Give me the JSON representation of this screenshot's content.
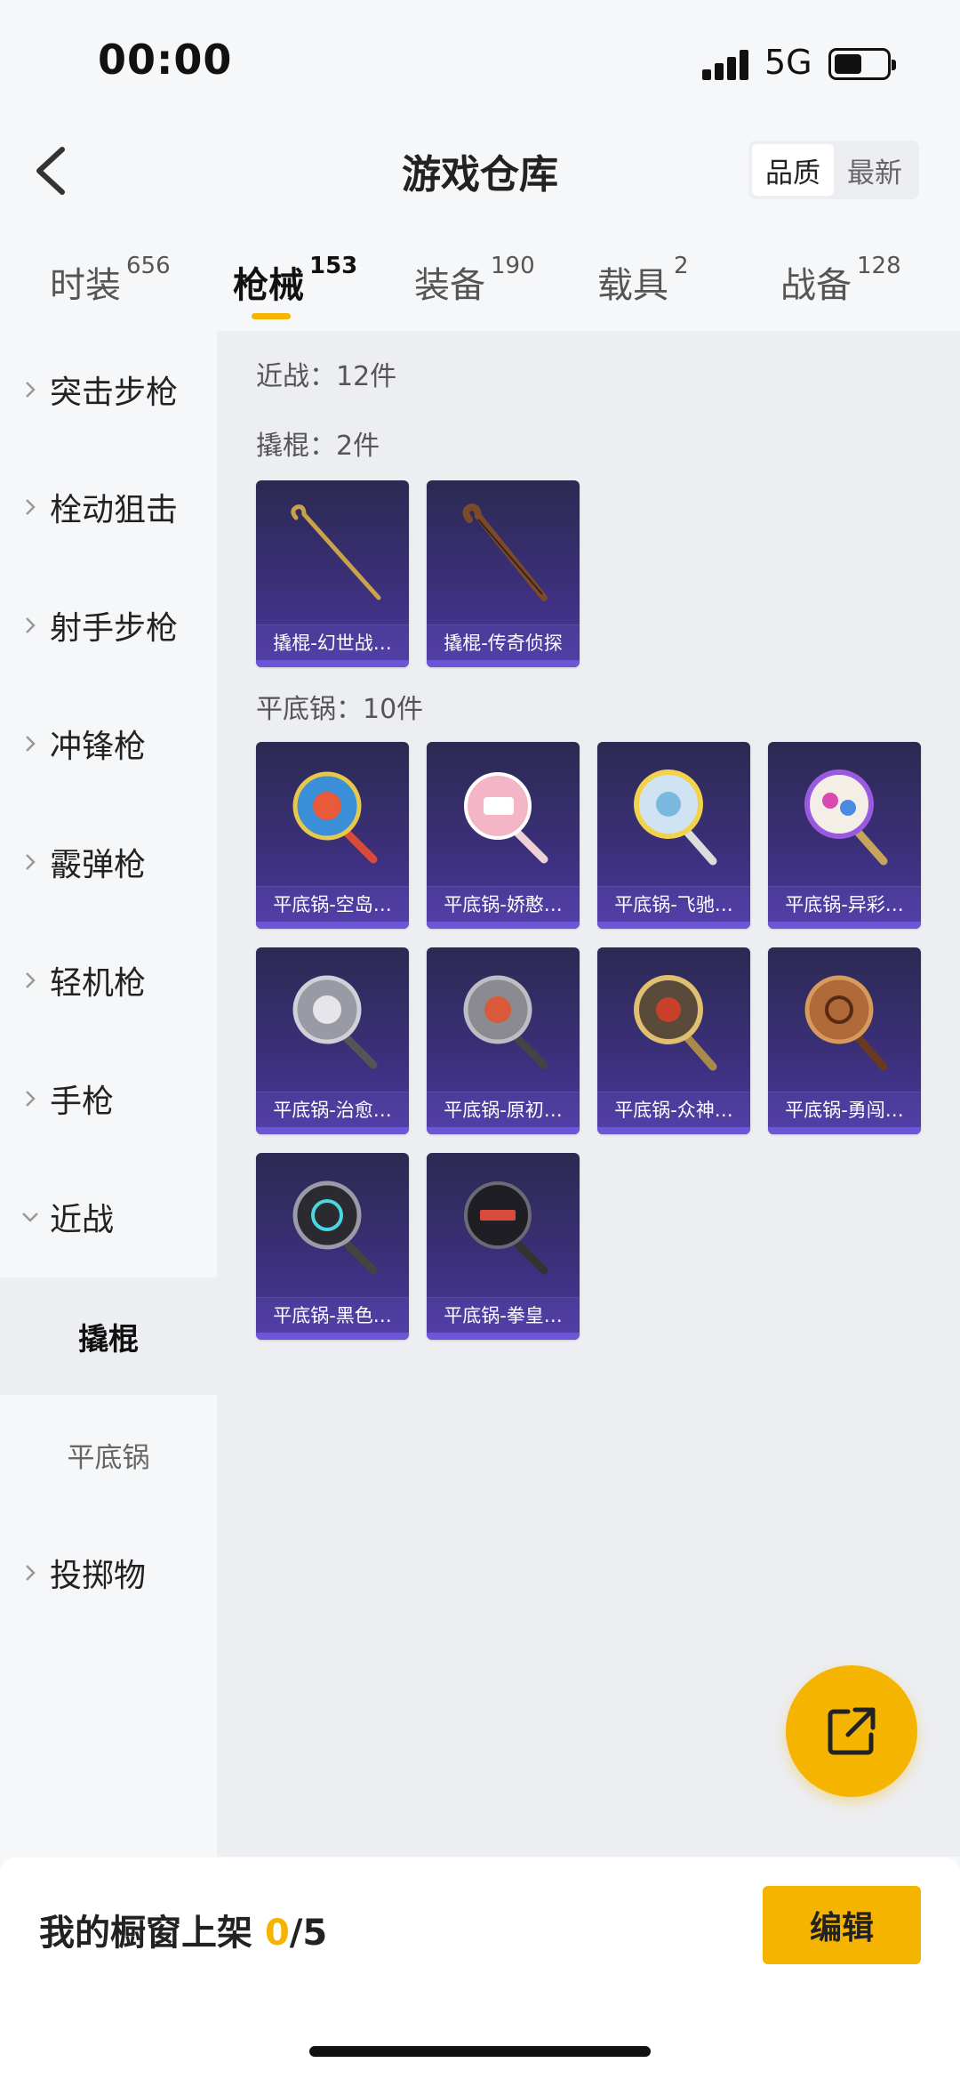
{
  "status": {
    "time": "00:00",
    "network": "5G",
    "battery_level": 0.5
  },
  "header": {
    "title": "游戏仓库",
    "sort_options": [
      "品质",
      "最新"
    ],
    "active_sort": 0
  },
  "tabs": [
    {
      "label": "时装",
      "count": "656"
    },
    {
      "label": "枪械",
      "count": "153"
    },
    {
      "label": "装备",
      "count": "190"
    },
    {
      "label": "载具",
      "count": "2"
    },
    {
      "label": "战备",
      "count": "128"
    }
  ],
  "sidebar": {
    "items": [
      {
        "label": "突击步枪"
      },
      {
        "label": "栓动狙击"
      },
      {
        "label": "射手步枪"
      },
      {
        "label": "冲锋枪"
      },
      {
        "label": "霰弹枪"
      },
      {
        "label": "轻机枪"
      },
      {
        "label": "手枪"
      },
      {
        "label": "近战"
      }
    ],
    "sub_items": [
      {
        "label": "撬棍"
      },
      {
        "label": "平底锅"
      }
    ],
    "last_item": {
      "label": "投掷物"
    }
  },
  "content": {
    "category_summary": "近战：12件",
    "groups": [
      {
        "label": "撬棍：2件",
        "items": [
          {
            "name": "撬棍-幻世战…"
          },
          {
            "name": "撬棍-传奇侦探"
          }
        ]
      },
      {
        "label": "平底锅：10件",
        "items": [
          {
            "name": "平底锅-空岛…"
          },
          {
            "name": "平底锅-娇憨…"
          },
          {
            "name": "平底锅-飞驰…"
          },
          {
            "name": "平底锅-异彩…"
          },
          {
            "name": "平底锅-治愈…"
          },
          {
            "name": "平底锅-原初…"
          },
          {
            "name": "平底锅-众神…"
          },
          {
            "name": "平底锅-勇闯…"
          },
          {
            "name": "平底锅-黑色…"
          },
          {
            "name": "平底锅-拳皇…"
          }
        ]
      }
    ]
  },
  "bottom": {
    "label_prefix": "我的橱窗上架 ",
    "current": "0",
    "total": "/5",
    "edit_label": "编辑"
  },
  "colors": {
    "accent": "#f5b400",
    "card_bg": "#3b2f78"
  }
}
